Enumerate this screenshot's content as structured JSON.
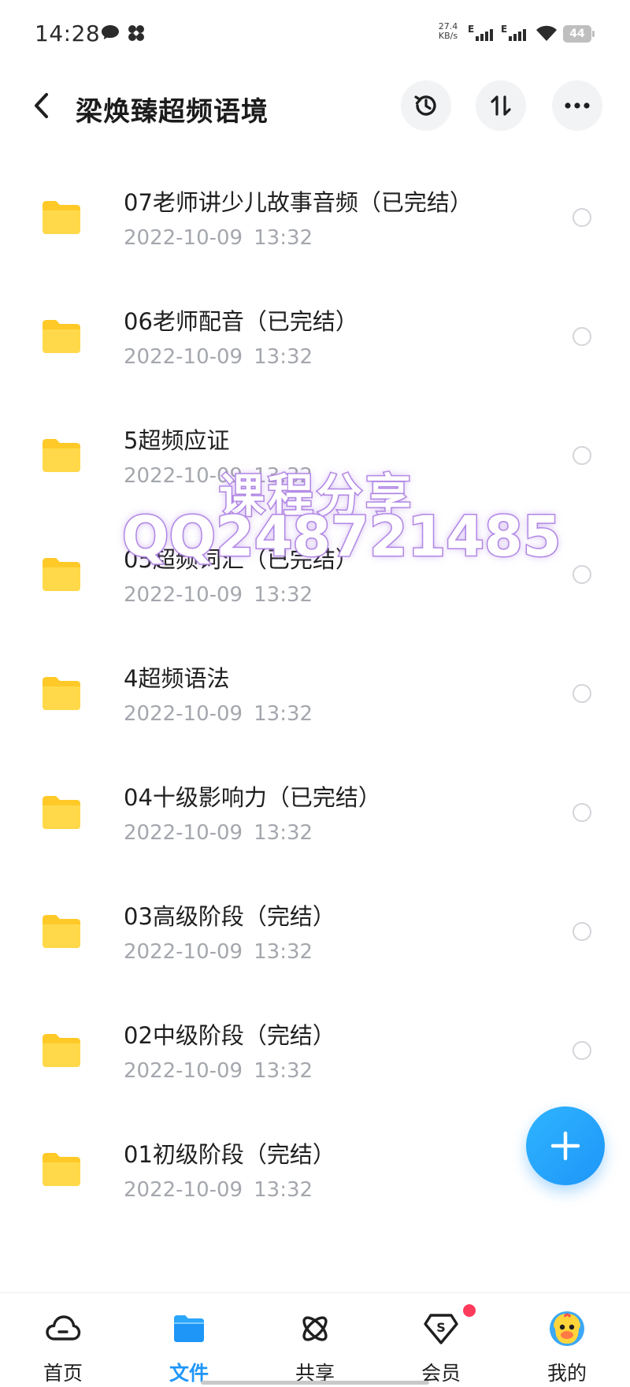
{
  "status_bar": {
    "time": "14:28",
    "net_speed_value": "27.4",
    "net_speed_unit": "KB/s",
    "network_type_1": "E",
    "network_type_2": "E",
    "battery_level": "44",
    "icons": [
      "chat-bubble-icon",
      "pinwheel-icon",
      "signal-icon",
      "signal-icon",
      "wifi-icon",
      "battery-icon"
    ]
  },
  "header": {
    "title": "梁焕臻超频语境",
    "icons": [
      "back-arrow-icon",
      "history-icon",
      "sort-icon",
      "more-icon"
    ]
  },
  "files": [
    {
      "name": "",
      "date": "2022-10-09",
      "time": "13:32"
    },
    {
      "name": "07老师讲少儿故事音频（已完结）",
      "date": "2022-10-09",
      "time": "13:32"
    },
    {
      "name": "06老师配音（已完结）",
      "date": "2022-10-09",
      "time": "13:32"
    },
    {
      "name": "5超频应证",
      "date": "2022-10-09",
      "time": "13:32"
    },
    {
      "name": "05超频词汇（已完结）",
      "date": "2022-10-09",
      "time": "13:32"
    },
    {
      "name": "4超频语法",
      "date": "2022-10-09",
      "time": "13:32"
    },
    {
      "name": "04十级影响力（已完结）",
      "date": "2022-10-09",
      "time": "13:32"
    },
    {
      "name": "03高级阶段（完结）",
      "date": "2022-10-09",
      "time": "13:32"
    },
    {
      "name": "02中级阶段（完结）",
      "date": "2022-10-09",
      "time": "13:32"
    },
    {
      "name": "01初级阶段（完结）",
      "date": "2022-10-09",
      "time": "13:32"
    }
  ],
  "watermark": {
    "line1": "课程分享",
    "line2": "QQ248721485"
  },
  "fab_icon": "plus-icon",
  "bottom_nav": {
    "items": [
      {
        "label": "首页",
        "icon": "cloud-icon",
        "active": false
      },
      {
        "label": "文件",
        "icon": "folder-icon",
        "active": true
      },
      {
        "label": "共享",
        "icon": "atom-icon",
        "active": false
      },
      {
        "label": "会员",
        "icon": "vip-diamond-icon",
        "active": false,
        "badge": true
      },
      {
        "label": "我的",
        "icon": "avatar-icon",
        "active": false
      }
    ]
  },
  "colors": {
    "accent": "#1e96f8",
    "folder": "#ffd43b",
    "date_text": "#a4a7ad",
    "badge": "#ff3b5c",
    "watermark_stroke": "#b48be4"
  }
}
